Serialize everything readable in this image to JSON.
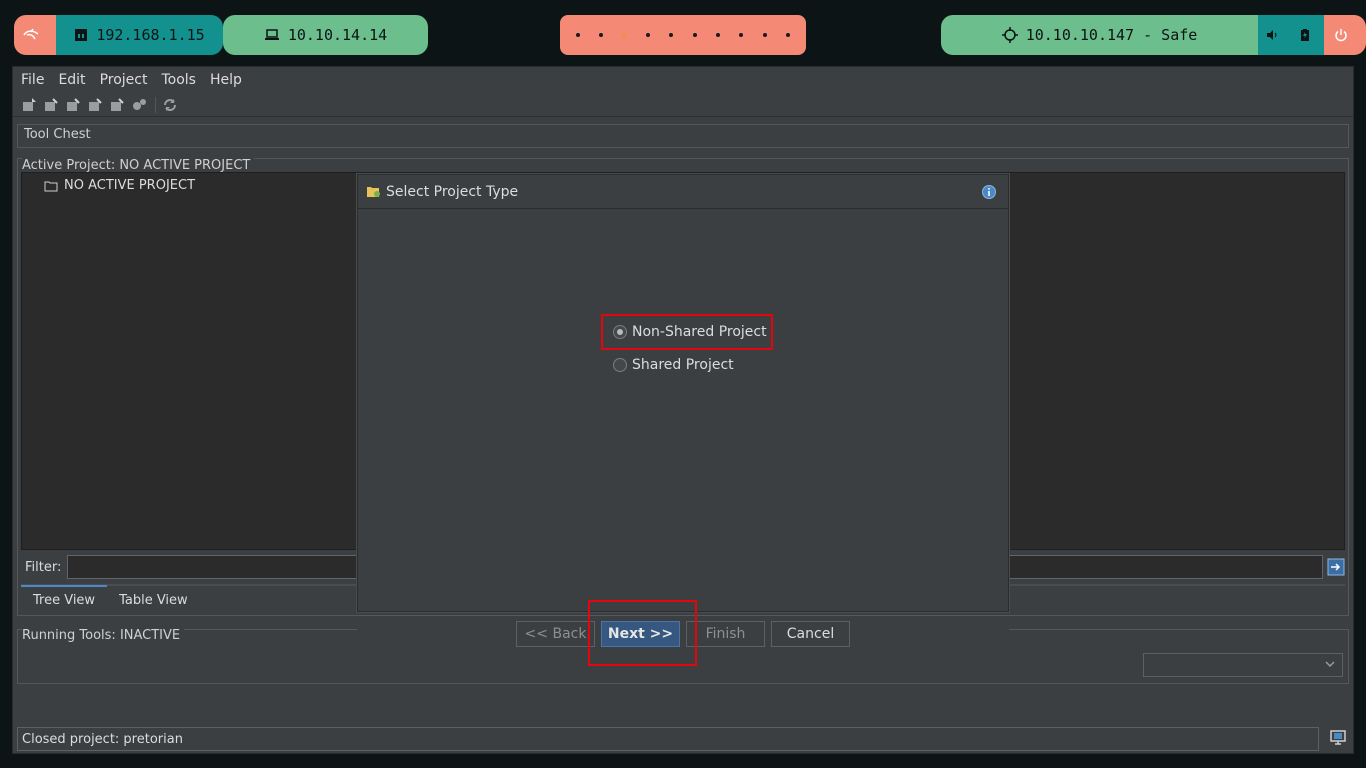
{
  "topbar": {
    "host_ip": "192.168.1.15",
    "vpn_ip": "10.10.14.14",
    "workspace_count": 10,
    "active_workspace": 3,
    "target": "10.10.10.147 - Safe"
  },
  "menu": {
    "items": [
      "File",
      "Edit",
      "Project",
      "Tools",
      "Help"
    ]
  },
  "tool_chest": {
    "title": "Tool Chest"
  },
  "active_project": {
    "title": "Active Project: NO ACTIVE PROJECT",
    "tree_node": "NO ACTIVE PROJECT"
  },
  "filter": {
    "label": "Filter:",
    "value": ""
  },
  "view_tabs": [
    "Tree View",
    "Table View"
  ],
  "running_tools": {
    "title": "Running Tools: INACTIVE"
  },
  "status": {
    "text": "Closed project: pretorian"
  },
  "dialog": {
    "title": "Select Project Type",
    "options": [
      {
        "label": "Non-Shared Project",
        "checked": true
      },
      {
        "label": "Shared Project",
        "checked": false
      }
    ],
    "buttons": {
      "back": "<< Back",
      "next": "Next >>",
      "finish": "Finish",
      "cancel": "Cancel"
    }
  },
  "colors": {
    "accent_salmon": "#f48a76",
    "accent_teal": "#12918f",
    "accent_green": "#6cbe8d",
    "highlight_red": "#e2070d",
    "primary_button": "#365880"
  }
}
